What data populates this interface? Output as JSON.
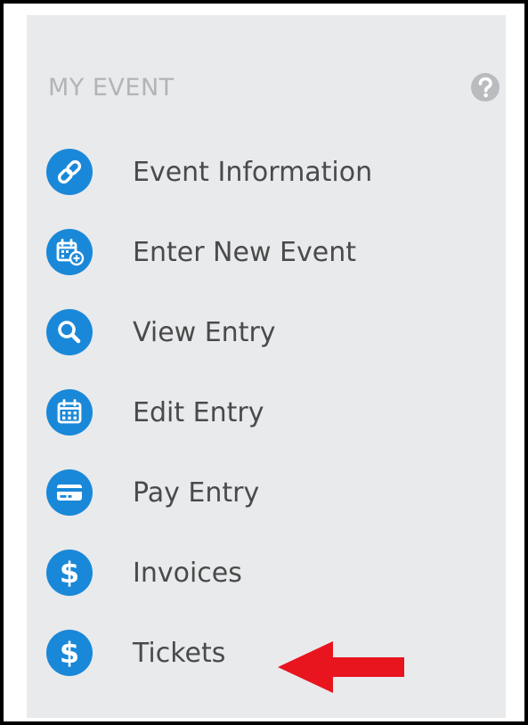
{
  "sidebar": {
    "section_title": "MY EVENT",
    "help_icon": "question-circle-icon",
    "items": [
      {
        "label": "Event Information",
        "icon": "link-icon"
      },
      {
        "label": "Enter New Event",
        "icon": "calendar-add-icon"
      },
      {
        "label": "View Entry",
        "icon": "search-icon"
      },
      {
        "label": "Edit Entry",
        "icon": "calendar-icon"
      },
      {
        "label": "Pay Entry",
        "icon": "credit-card-icon"
      },
      {
        "label": "Invoices",
        "icon": "dollar-icon"
      },
      {
        "label": "Tickets",
        "icon": "dollar-icon"
      }
    ]
  },
  "annotation": {
    "arrow_color": "#e8141e",
    "points_to": "Tickets"
  },
  "colors": {
    "accent": "#1a88d8",
    "panel_bg": "#e9eaec",
    "label_text": "#4a4a4a",
    "header_text": "#b2b4b8"
  }
}
